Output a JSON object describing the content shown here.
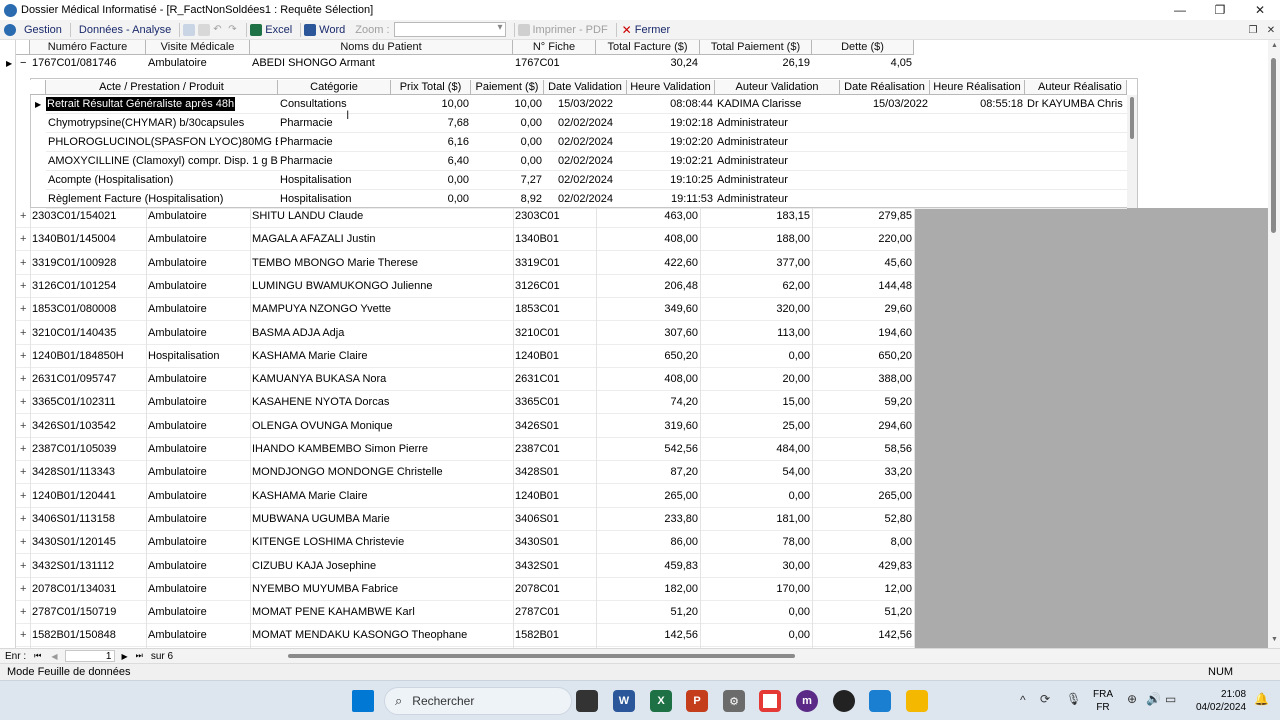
{
  "window": {
    "title": "Dossier Médical Informatisé - [R_FactNonSoldées1 : Requête Sélection]",
    "min_label": "—",
    "max_label": "❐",
    "close_label": "✕"
  },
  "menu": {
    "gestion": "Gestion",
    "donnees": "Données - Analyse",
    "excel": "Excel",
    "word": "Word",
    "zoom": "Zoom :",
    "imprimer": "Imprimer - PDF",
    "fermer": "Fermer"
  },
  "columns": [
    "Numéro Facture",
    "Visite Médicale",
    "Noms du Patient",
    "N° Fiche",
    "Total Facture ($)",
    "Total Paiement ($)",
    "Dette ($)"
  ],
  "expanded_row": {
    "marker": "▶",
    "toggle": "−",
    "numero": "1767C01/081746",
    "visite": "Ambulatoire",
    "patient": "ABEDI SHONGO Armant",
    "fiche": "1767C01",
    "total": "30,24",
    "paiement": "26,19",
    "dette": "4,05"
  },
  "sub_columns": [
    "Acte / Prestation / Produit",
    "Catégorie",
    "Prix Total ($)",
    "Paiement ($)",
    "Date Validation",
    "Heure Validation",
    "Auteur Validation",
    "Date Réalisation",
    "Heure Réalisation",
    "Auteur Réalisatio"
  ],
  "sub_rows": [
    {
      "acte": "Retrait Résultat Généraliste après 48h",
      "cat": "Consultations",
      "prix": "10,00",
      "paie": "10,00",
      "dval": "15/03/2022",
      "hval": "08:08:44",
      "aval": "KADIMA Clarisse",
      "dreal": "15/03/2022",
      "hreal": "08:55:18",
      "areal": "Dr KAYUMBA Chris"
    },
    {
      "acte": "Chymotrypsine(CHYMAR) b/30capsules",
      "cat": "Pharmacie",
      "prix": "7,68",
      "paie": "0,00",
      "dval": "02/02/2024",
      "hval": "19:02:18",
      "aval": "Administrateur",
      "dreal": "",
      "hreal": "",
      "areal": ""
    },
    {
      "acte": "PHLOROGLUCINOL(SPASFON LYOC)80MG B",
      "cat": "Pharmacie",
      "prix": "6,16",
      "paie": "0,00",
      "dval": "02/02/2024",
      "hval": "19:02:20",
      "aval": "Administrateur",
      "dreal": "",
      "hreal": "",
      "areal": ""
    },
    {
      "acte": "AMOXYCILLINE (Clamoxyl) compr. Disp. 1 g B",
      "cat": "Pharmacie",
      "prix": "6,40",
      "paie": "0,00",
      "dval": "02/02/2024",
      "hval": "19:02:21",
      "aval": "Administrateur",
      "dreal": "",
      "hreal": "",
      "areal": ""
    },
    {
      "acte": "Acompte (Hospitalisation)",
      "cat": "Hospitalisation",
      "prix": "0,00",
      "paie": "7,27",
      "dval": "02/02/2024",
      "hval": "19:10:25",
      "aval": "Administrateur",
      "dreal": "",
      "hreal": "",
      "areal": ""
    },
    {
      "acte": "Règlement Facture (Hospitalisation)",
      "cat": "Hospitalisation",
      "prix": "0,00",
      "paie": "8,92",
      "dval": "02/02/2024",
      "hval": "19:11:53",
      "aval": "Administrateur",
      "dreal": "",
      "hreal": "",
      "areal": ""
    }
  ],
  "rows": [
    {
      "numero": "2303C01/154021",
      "visite": "Ambulatoire",
      "patient": "SHITU LANDU Claude",
      "fiche": "2303C01",
      "total": "463,00",
      "paiement": "183,15",
      "dette": "279,85"
    },
    {
      "numero": "1340B01/145004",
      "visite": "Ambulatoire",
      "patient": "MAGALA AFAZALI Justin",
      "fiche": "1340B01",
      "total": "408,00",
      "paiement": "188,00",
      "dette": "220,00"
    },
    {
      "numero": "3319C01/100928",
      "visite": "Ambulatoire",
      "patient": "TEMBO MBONGO Marie Therese",
      "fiche": "3319C01",
      "total": "422,60",
      "paiement": "377,00",
      "dette": "45,60"
    },
    {
      "numero": "3126C01/101254",
      "visite": "Ambulatoire",
      "patient": "LUMINGU BWAMUKONGO Julienne",
      "fiche": "3126C01",
      "total": "206,48",
      "paiement": "62,00",
      "dette": "144,48"
    },
    {
      "numero": "1853C01/080008",
      "visite": "Ambulatoire",
      "patient": "MAMPUYA NZONGO Yvette",
      "fiche": "1853C01",
      "total": "349,60",
      "paiement": "320,00",
      "dette": "29,60"
    },
    {
      "numero": "3210C01/140435",
      "visite": "Ambulatoire",
      "patient": "BASMA ADJA Adja",
      "fiche": "3210C01",
      "total": "307,60",
      "paiement": "113,00",
      "dette": "194,60"
    },
    {
      "numero": "1240B01/184850H",
      "visite": "Hospitalisation",
      "patient": "KASHAMA  Marie Claire",
      "fiche": "1240B01",
      "total": "650,20",
      "paiement": "0,00",
      "dette": "650,20"
    },
    {
      "numero": "2631C01/095747",
      "visite": "Ambulatoire",
      "patient": "KAMUANYA BUKASA Nora",
      "fiche": "2631C01",
      "total": "408,00",
      "paiement": "20,00",
      "dette": "388,00"
    },
    {
      "numero": "3365C01/102311",
      "visite": "Ambulatoire",
      "patient": "KASAHENE NYOTA Dorcas",
      "fiche": "3365C01",
      "total": "74,20",
      "paiement": "15,00",
      "dette": "59,20"
    },
    {
      "numero": "3426S01/103542",
      "visite": "Ambulatoire",
      "patient": "OLENGA OVUNGA Monique",
      "fiche": "3426S01",
      "total": "319,60",
      "paiement": "25,00",
      "dette": "294,60"
    },
    {
      "numero": "2387C01/105039",
      "visite": "Ambulatoire",
      "patient": "IHANDO KAMBEMBO Simon Pierre",
      "fiche": "2387C01",
      "total": "542,56",
      "paiement": "484,00",
      "dette": "58,56"
    },
    {
      "numero": "3428S01/113343",
      "visite": "Ambulatoire",
      "patient": "MONDJONGO MONDONGE Christelle",
      "fiche": "3428S01",
      "total": "87,20",
      "paiement": "54,00",
      "dette": "33,20"
    },
    {
      "numero": "1240B01/120441",
      "visite": "Ambulatoire",
      "patient": "KASHAMA  Marie Claire",
      "fiche": "1240B01",
      "total": "265,00",
      "paiement": "0,00",
      "dette": "265,00"
    },
    {
      "numero": "3406S01/113158",
      "visite": "Ambulatoire",
      "patient": "MUBWANA UGUMBA Marie",
      "fiche": "3406S01",
      "total": "233,80",
      "paiement": "181,00",
      "dette": "52,80"
    },
    {
      "numero": "3430S01/120145",
      "visite": "Ambulatoire",
      "patient": "KITENGE LOSHIMA Christevie",
      "fiche": "3430S01",
      "total": "86,00",
      "paiement": "78,00",
      "dette": "8,00"
    },
    {
      "numero": "3432S01/131112",
      "visite": "Ambulatoire",
      "patient": "CIZUBU KAJA Josephine",
      "fiche": "3432S01",
      "total": "459,83",
      "paiement": "30,00",
      "dette": "429,83"
    },
    {
      "numero": "2078C01/134031",
      "visite": "Ambulatoire",
      "patient": "NYEMBO MUYUMBA Fabrice",
      "fiche": "2078C01",
      "total": "182,00",
      "paiement": "170,00",
      "dette": "12,00"
    },
    {
      "numero": "2787C01/150719",
      "visite": "Ambulatoire",
      "patient": "MOMAT PENE KAHAMBWE Karl",
      "fiche": "2787C01",
      "total": "51,20",
      "paiement": "0,00",
      "dette": "51,20"
    },
    {
      "numero": "1582B01/150848",
      "visite": "Ambulatoire",
      "patient": "MOMAT MENDAKU KASONGO Theophane",
      "fiche": "1582B01",
      "total": "142,56",
      "paiement": "0,00",
      "dette": "142,56"
    }
  ],
  "nav": {
    "label": "Enr :",
    "first": "⏮",
    "prev": "◀",
    "current": "1",
    "next": "▶",
    "last": "⏭",
    "of": "sur 6"
  },
  "status": {
    "text": "Mode Feuille de données",
    "num": "NUM"
  },
  "taskbar": {
    "search": "Rechercher",
    "lang1": "FRA",
    "lang2": "FR",
    "time": "21:08",
    "date": "04/02/2024"
  },
  "colors": {
    "accent": "#0078d4",
    "selection": "#000000",
    "gray": "#ababab"
  }
}
